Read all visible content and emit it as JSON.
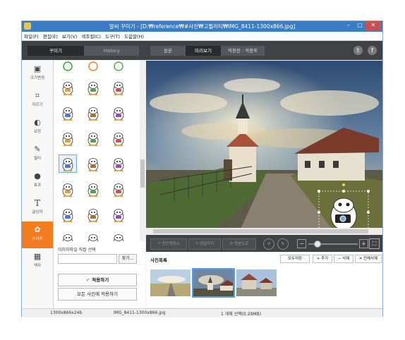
{
  "window": {
    "title": "알씨 꾸미기 - [D:₩reference₩#사진₩고찔리티₩IMG_8411-1300x866.jpg]",
    "controls": {
      "minimize": "–",
      "maximize": "□",
      "close": "✕"
    }
  },
  "menubar": {
    "items": [
      {
        "label": "파일(F)"
      },
      {
        "label": "편집(E)"
      },
      {
        "label": "보기(V)"
      },
      {
        "label": "색조절(C)"
      },
      {
        "label": "도구(T)"
      },
      {
        "label": "도움말(H)"
      }
    ]
  },
  "tabs": {
    "left": [
      {
        "label": "꾸미기",
        "active": true
      },
      {
        "label": "History",
        "active": false
      }
    ],
    "view": [
      {
        "label": "원본",
        "active": false
      },
      {
        "label": "미리보기",
        "active": true
      },
      {
        "label": "적용전 : 적용후",
        "active": false
      }
    ],
    "social": {
      "twitter": "t",
      "facebook": "f"
    }
  },
  "sidebar": {
    "items": [
      {
        "label": "크기변경",
        "icon": "resize-icon",
        "glyph": "▣"
      },
      {
        "label": "자르기",
        "icon": "crop-icon",
        "glyph": "⌗"
      },
      {
        "label": "보정",
        "icon": "adjust-icon",
        "glyph": "◐"
      },
      {
        "label": "필터",
        "icon": "filter-icon",
        "glyph": "✎"
      },
      {
        "label": "효과",
        "icon": "effect-icon",
        "glyph": "●"
      },
      {
        "label": "글상자",
        "icon": "textbox-icon",
        "glyph": "T"
      },
      {
        "label": "스티커",
        "icon": "sticker-icon",
        "glyph": "✿",
        "active": true
      },
      {
        "label": "액자",
        "icon": "frame-icon",
        "glyph": "▦"
      }
    ]
  },
  "sticker_panel": {
    "file_label": "이미지파일 직접 선택",
    "file_value": "",
    "find_button": "찾기...",
    "apply_button": "적용하기",
    "apply_all_button": "모든 사진에 적용하기",
    "checkmark": "✔"
  },
  "view_toolbar": {
    "undo": "전단계취소",
    "redo": "되살리기",
    "original": "원본으로",
    "rotate_left": "↺",
    "rotate_right": "↻",
    "zoom_minus": "−",
    "zoom_plus": "+",
    "fit": "⛶"
  },
  "photo_list": {
    "title": "사진목록",
    "save_all": "모두저장",
    "add": "+ 추가",
    "delete": "− 삭제",
    "delete_all": "✕ 전체삭제"
  },
  "statusbar": {
    "dimensions": "1300x866x24b",
    "filename": "IMG_8411-1300x866.jpg",
    "selection": "1 개체 선택(0.29MB)"
  },
  "colors": {
    "accent": "#f27c1f",
    "titlebar": "#3b7dc4",
    "dark_toolbar": "#404246"
  }
}
